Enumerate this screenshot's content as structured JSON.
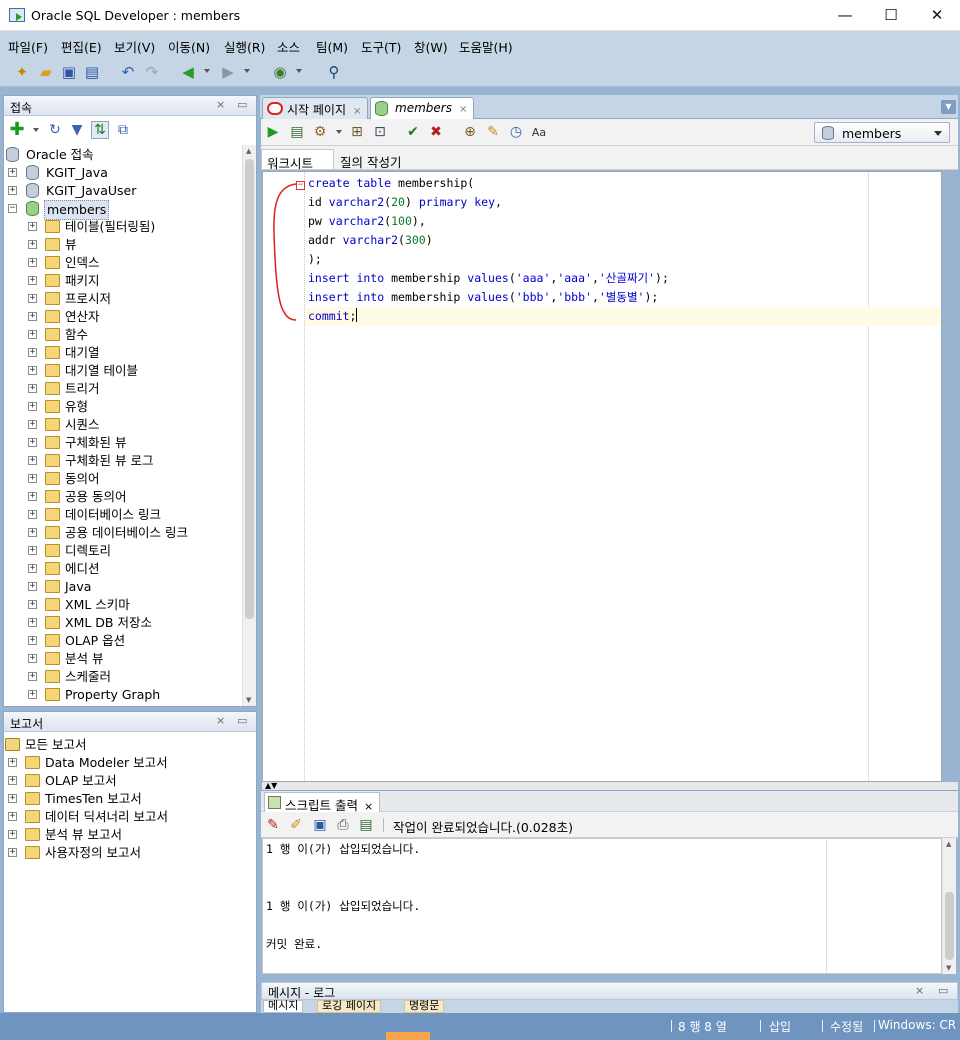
{
  "window": {
    "title": "Oracle SQL Developer : members",
    "controls": {
      "minimize": "—",
      "maximize": "☐",
      "close": "✕"
    }
  },
  "menu": [
    "파일(F)",
    "편집(E)",
    "보기(V)",
    "이동(N)",
    "실행(R)",
    "소스",
    "팀(M)",
    "도구(T)",
    "창(W)",
    "도움말(H)"
  ],
  "connections_panel": {
    "title": "접속",
    "root": "Oracle 접속",
    "connections": [
      {
        "label": "KGIT_Java"
      },
      {
        "label": "KGIT_JavaUser"
      },
      {
        "label": "members"
      }
    ],
    "members_children": [
      "테이블(필터링됨)",
      "뷰",
      "인덱스",
      "패키지",
      "프로시저",
      "연산자",
      "함수",
      "대기열",
      "대기열 테이블",
      "트리거",
      "유형",
      "시퀀스",
      "구체화된 뷰",
      "구체화된 뷰 로그",
      "동의어",
      "공용 동의어",
      "데이터베이스 링크",
      "공용 데이터베이스 링크",
      "디렉토리",
      "에디션",
      "Java",
      "XML 스키마",
      "XML DB 저장소",
      "OLAP 옵션",
      "분석 뷰",
      "스케줄러",
      "Property Graph"
    ]
  },
  "reports_panel": {
    "title": "보고서",
    "root": "모든 보고서",
    "items": [
      "Data Modeler 보고서",
      "OLAP 보고서",
      "TimesTen 보고서",
      "데이터 딕셔너리 보고서",
      "분석 뷰 보고서",
      "사용자정의 보고서"
    ]
  },
  "doc_tabs": [
    {
      "label": "시작 페이지",
      "active": false
    },
    {
      "label": "members",
      "active": true
    }
  ],
  "editor": {
    "connection": "members",
    "sub_tabs": [
      "워크시트",
      "질의 작성기"
    ],
    "lines": [
      "create table membership(",
      "id varchar2(20) primary key,",
      "pw varchar2(100),",
      "addr varchar2(300)",
      ");",
      "insert into membership values('aaa','aaa','산골짜기');",
      "insert into membership values('bbb','bbb','별동별');",
      "commit;"
    ]
  },
  "script_output": {
    "tab_label": "스크립트 출력",
    "status": "작업이 완료되었습니다.(0.028초)",
    "lines": [
      "1 행 이(가) 삽입되었습니다.",
      "1 행 이(가) 삽입되었습니다.",
      "커밋 완료."
    ]
  },
  "messages": {
    "title": "메시지 - 로그",
    "tabs": [
      "메시지",
      "로깅 페이지",
      "명령문"
    ]
  },
  "statusbar": {
    "position": "8 행 8 열",
    "insert_mode": "삽입",
    "modified": "수정됨",
    "line_ending": "Windows: CR"
  },
  "colors": {
    "keyword": "#0000cc",
    "number": "#0a7a2a",
    "string": "#0000cc",
    "statusbar": "#6f94c0",
    "chrome": "#c6d5e6",
    "annotation": "#e02020"
  }
}
